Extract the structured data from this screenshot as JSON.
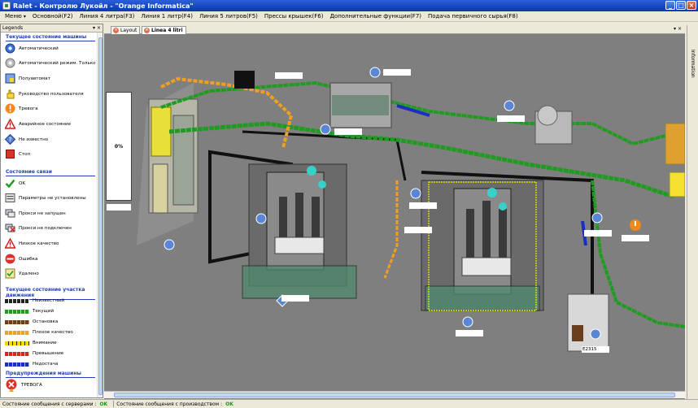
{
  "window": {
    "title": "Ralet - Контролю Лукойл - \"Orange Informatica\""
  },
  "menu": [
    {
      "label": "Меню",
      "chevron": true
    },
    {
      "label": "Основной(F2)"
    },
    {
      "label": "Линия 4 литра(F3)"
    },
    {
      "label": "Линия 1 литр(F4)"
    },
    {
      "label": "Линия 5 литров(F5)"
    },
    {
      "label": "Прессы крышек(F6)"
    },
    {
      "label": "Дополнительные функции(F7)"
    },
    {
      "label": "Подача первичного сырья(F8)"
    }
  ],
  "legend": {
    "header": "Legends",
    "machine_state_title": "Текущее состояние машины",
    "machine_states": [
      {
        "label": "Автоматический",
        "icon": "gear-blue-icon"
      },
      {
        "label": "Автоматический режим. Только",
        "icon": "gear-gray-icon"
      },
      {
        "label": "Полуавтомат",
        "icon": "semi-auto-icon"
      },
      {
        "label": "Руководство пользователя",
        "icon": "hand-icon"
      },
      {
        "label": "Тревога",
        "icon": "alarm-icon"
      },
      {
        "label": "Аварийное состояние",
        "icon": "warning-icon"
      },
      {
        "label": "Не известно",
        "icon": "unknown-icon"
      },
      {
        "label": "Стоп",
        "icon": "stop-icon"
      }
    ],
    "connection_title": "Состояние связи",
    "connection_states": [
      {
        "label": "OK",
        "icon": "check-icon"
      },
      {
        "label": "Параметры не установлены",
        "icon": "params-icon"
      },
      {
        "label": "Прокси не запущен",
        "icon": "proxy-icon"
      },
      {
        "label": "Прокси не подключен",
        "icon": "proxy-disconnected-icon"
      },
      {
        "label": "Низкое качество",
        "icon": "low-quality-icon"
      },
      {
        "label": "Ошибка",
        "icon": "error-icon"
      },
      {
        "label": "Удалено",
        "icon": "deleted-icon"
      }
    ],
    "section_state_title": "Текущее состояние участка движения",
    "section_states": [
      {
        "label": "Неизвестный",
        "color": "#222222"
      },
      {
        "label": "Текущий",
        "color": "#1f9c1f"
      },
      {
        "label": "Остановка",
        "color": "#6b3f1e"
      },
      {
        "label": "Плохое качество",
        "color": "#f0a020"
      },
      {
        "label": "Внимание",
        "color": "#f5d800"
      },
      {
        "label": "Превышение",
        "color": "#e02020"
      },
      {
        "label": "Недостача",
        "color": "#1b2fbf"
      }
    ],
    "warning_title": "Предупреждения машины",
    "warnings": [
      {
        "label": "ТРЕВОГА",
        "icon": "alarm-x-icon"
      }
    ]
  },
  "tabs": [
    {
      "label": "Layout",
      "active": false
    },
    {
      "label": "Linea 4 litri",
      "active": true
    }
  ],
  "info_sidebar": {
    "label": "Information"
  },
  "canvas": {
    "fill_label": "0%",
    "tag_label": "E2315"
  },
  "status": {
    "server_label": "Состояние сообщения с серверами :",
    "server_value": "OK",
    "production_label": "Состояние сообщения с производством :",
    "production_value": "OK"
  },
  "colors": {
    "line_green": "#1f9c1f",
    "line_orange": "#f0a020",
    "line_blue": "#1b2fbf",
    "selection": "#f5f000"
  }
}
